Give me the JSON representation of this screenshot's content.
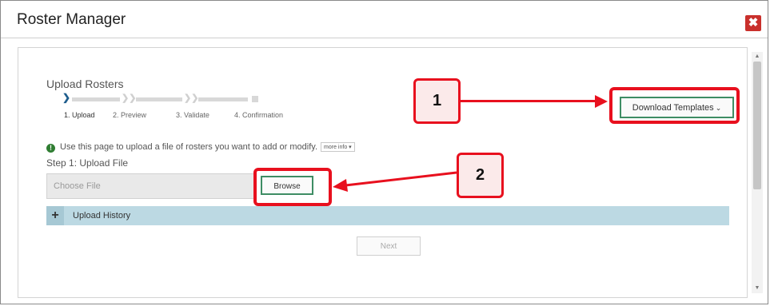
{
  "dialog": {
    "title": "Roster Manager",
    "close_icon": "close-icon",
    "close_glyph": "✖"
  },
  "upload": {
    "heading": "Upload Rosters",
    "steps": [
      "1. Upload",
      "2. Preview",
      "3. Validate",
      "4. Confirmation"
    ],
    "active_step": 1,
    "info_text": "Use this page to upload a file of rosters you want to add or modify.",
    "more_info_label": "more info",
    "step1_label": "Step 1: Upload File",
    "file_placeholder": "Choose File",
    "browse_label": "Browse",
    "history_label": "Upload History",
    "next_label": "Next",
    "download_templates_label": "Download Templates"
  },
  "callouts": [
    {
      "number": "1"
    },
    {
      "number": "2"
    }
  ],
  "colors": {
    "accent_green": "#3e8d64",
    "callout_red": "#e8101e",
    "close_red": "#c9302c",
    "history_bar": "#bcd9e3"
  }
}
